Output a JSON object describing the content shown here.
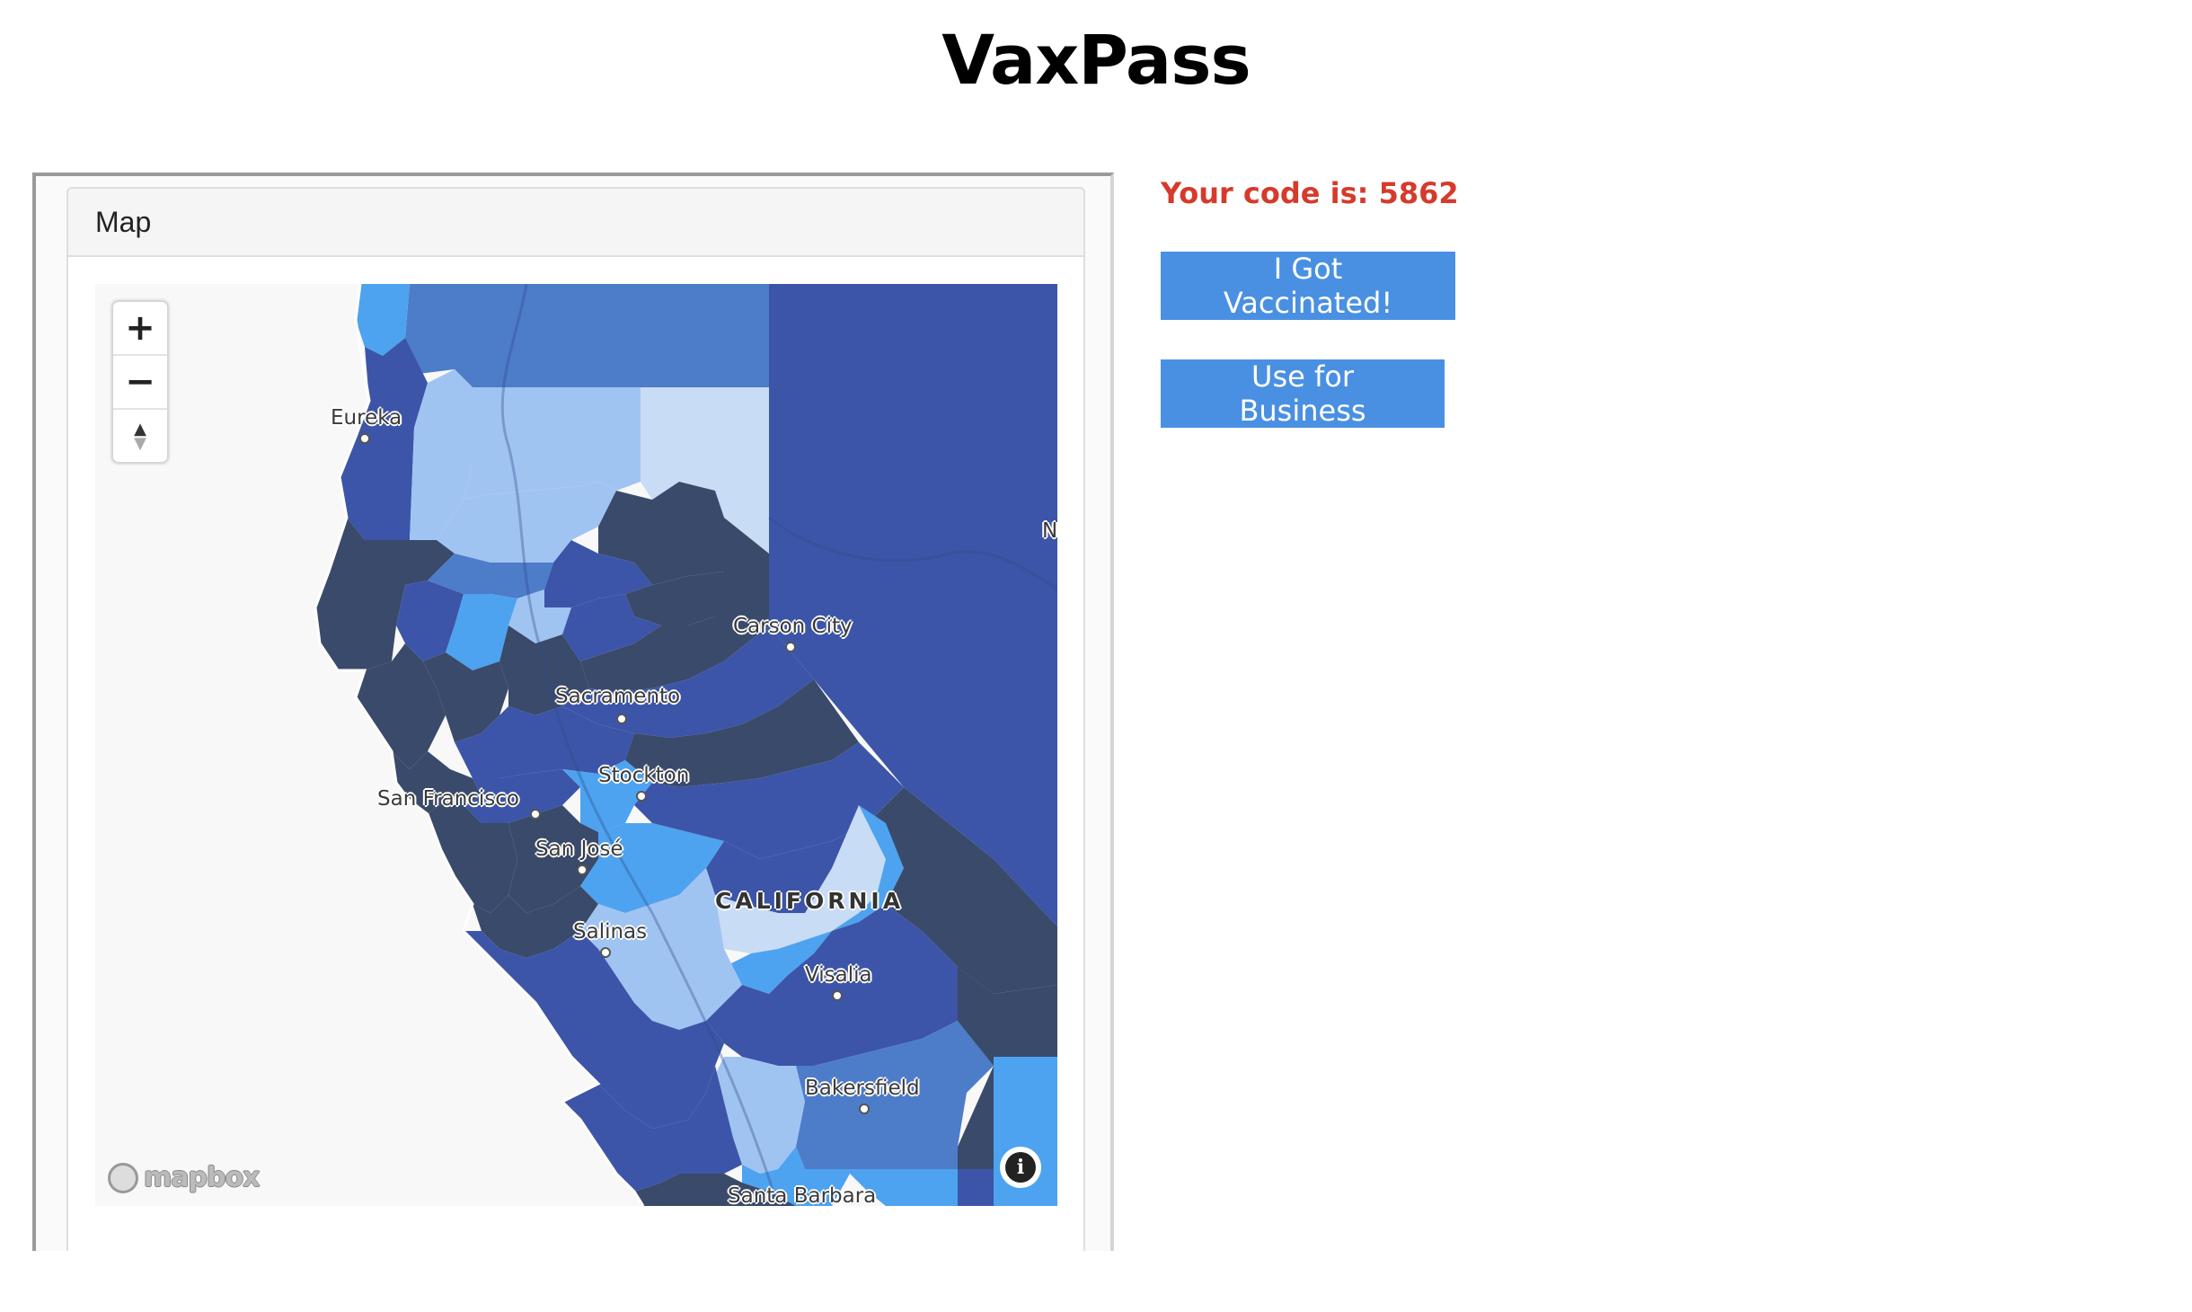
{
  "page": {
    "title": "VaxPass"
  },
  "panel": {
    "header": "Map"
  },
  "map": {
    "controls": {
      "zoom_in": "+",
      "zoom_out": "−",
      "compass_up": "▲",
      "compass_down": "▼"
    },
    "labels": {
      "eureka": "Eureka",
      "carson_city": "Carson City",
      "sacramento": "Sacramento",
      "stockton": "Stockton",
      "san_francisco": "San Francisco",
      "san_jose": "San José",
      "california": "CALIFORNIA",
      "salinas": "Salinas",
      "visalia": "Visalia",
      "bakersfield": "Bakersfield",
      "santa_barbara": "Santa Barbara",
      "nevada_edge": "N"
    },
    "attribution": "mapbox",
    "info_icon": "info-icon",
    "colors": {
      "darkest": "#3a4a6b",
      "dark": "#3c55a8",
      "mid": "#4d7cc9",
      "bright": "#4da3ef",
      "light": "#a0c4f2",
      "pale": "#c8dcf5"
    }
  },
  "sidebar": {
    "code_text": "Your code is: 5862",
    "vaccinated_button": "I Got Vaccinated!",
    "business_button": "Use for Business"
  }
}
